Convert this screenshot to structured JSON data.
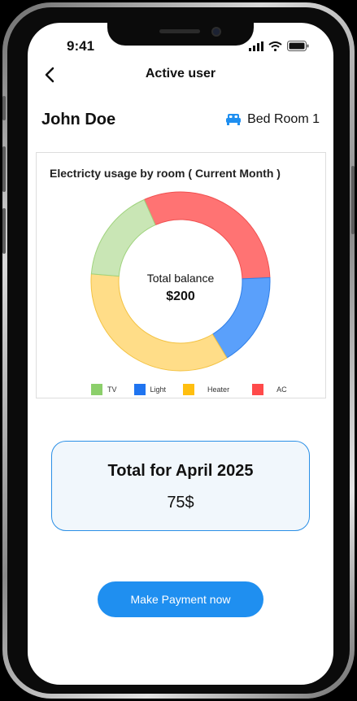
{
  "status_bar": {
    "time": "9:41"
  },
  "nav": {
    "title": "Active user"
  },
  "user": {
    "name": "John Doe",
    "room": "Bed Room 1"
  },
  "colors": {
    "accent": "#1f8ff0",
    "tv": "#c9e6b5",
    "light": "#5aa0fb",
    "heater": "#ffdd88",
    "ac": "#ff7373"
  },
  "chart_data": {
    "type": "pie",
    "style": "donut",
    "title": "Electricty usage by room ( Current Month )",
    "center_label": "Total balance",
    "center_value": "$200",
    "slices": [
      {
        "label": "AC",
        "value": 0.31,
        "color": "#ff7373",
        "stroke": "#f05050"
      },
      {
        "label": "Light",
        "value": 0.17,
        "color": "#5aa0fb",
        "stroke": "#2f7fe8"
      },
      {
        "label": "Heater",
        "value": 0.35,
        "color": "#ffdd88",
        "stroke": "#f3c242"
      },
      {
        "label": "TV",
        "value": 0.17,
        "color": "#c9e6b5",
        "stroke": "#9fd37d"
      }
    ],
    "legend": [
      {
        "label": "TV",
        "color": "#8ccf6b"
      },
      {
        "label": "Light",
        "color": "#1f74f0"
      },
      {
        "label": "Heater",
        "color": "#ffbf10"
      },
      {
        "label": "AC",
        "color": "#ff4a4a"
      }
    ],
    "legend_position": "bottom"
  },
  "total": {
    "title": "Total for April 2025",
    "value": "75$"
  },
  "payment": {
    "button_label": "Make Payment now"
  }
}
